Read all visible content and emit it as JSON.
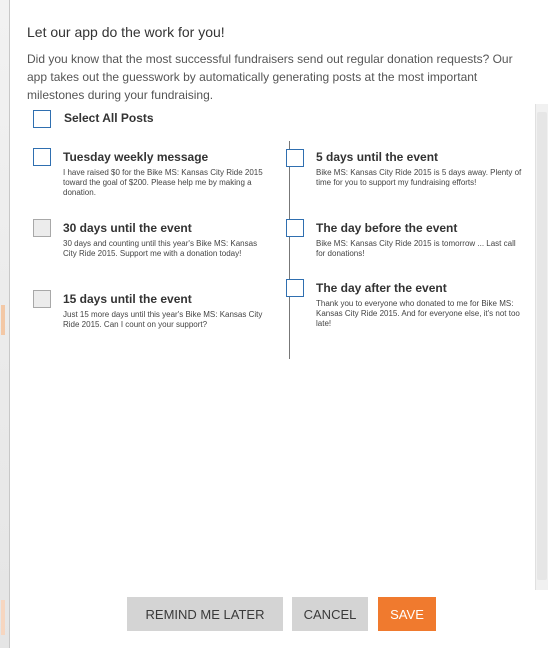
{
  "dialog": {
    "title": "Let our app do the work for you!",
    "intro": "Did you know that the most successful fundraisers send out regular donation requests? Our app takes out the guesswork by automatically generating posts at the most important milestones during your fundraising."
  },
  "select_all": {
    "label": "Select All Posts"
  },
  "posts": {
    "left": [
      {
        "title": "Tuesday weekly message",
        "body": "I have raised $0 for the Bike MS: Kansas City Ride 2015 toward the goal of $200. Please help me by making a donation."
      },
      {
        "title": "30 days until the event",
        "body": "30 days and counting until this year's Bike MS: Kansas City Ride 2015. Support me with a donation today!"
      },
      {
        "title": "15 days until the event",
        "body": "Just 15 more days until this year's Bike MS: Kansas City Ride 2015. Can I count on your support?"
      }
    ],
    "right": [
      {
        "title": "5 days until the event",
        "body": "Bike MS: Kansas City Ride 2015 is 5 days away. Plenty of time for you to support my fundraising efforts!"
      },
      {
        "title": "The day before the event",
        "body": "Bike MS: Kansas City Ride 2015 is tomorrow ... Last call for donations!"
      },
      {
        "title": "The day after the event",
        "body": "Thank you to everyone who donated to me for Bike MS: Kansas City Ride 2015. And for everyone else, it's not too late!"
      }
    ]
  },
  "buttons": {
    "remind": "REMIND ME LATER",
    "cancel": "CANCEL",
    "save": "SAVE"
  },
  "colors": {
    "save_button": "#f07a2e",
    "checkbox_border": "#2f6fb0",
    "secondary_button": "#d4d4d4"
  }
}
